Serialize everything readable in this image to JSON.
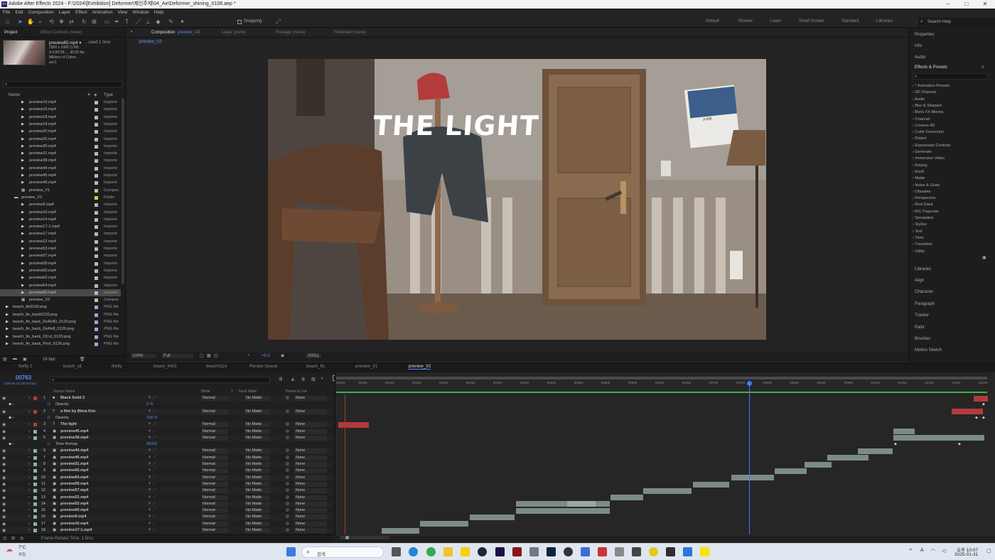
{
  "window_title": "Adobe After Effects 2024 - F:\\2024\\[Exhibition] Deformer\\제인주제\\04_Ae\\Deformer_shining_0108.aep *",
  "menu": [
    "File",
    "Edit",
    "Composition",
    "Layer",
    "Effect",
    "Animation",
    "View",
    "Window",
    "Help"
  ],
  "toolbar": {
    "snapping_label": "Snapping",
    "workspaces": [
      "Default",
      "Review",
      "Learn",
      "Small Screen",
      "Standard",
      "Libraries"
    ],
    "search_help": "Search Help"
  },
  "project": {
    "tab_project": "Project",
    "tab_effect_controls": "Effect Controls (none)",
    "thumb_name": "preview65.mp4 ▾",
    "thumb_used": ", used 1 time",
    "thumb_info1": "2560 x 1080 (1.00)",
    "thumb_info2": "Δ 0;00;08;..., 30.00 fps",
    "thumb_info3": "Millions of Colors",
    "thumb_info4": "avc1",
    "col_name": "Name",
    "col_type": "Type",
    "items": [
      {
        "name": "preview15.mp4",
        "type": "Importe",
        "indent": 2,
        "color": "#aebbc8"
      },
      {
        "name": "preview16.mp4",
        "type": "Importe",
        "indent": 2,
        "color": "#aebbc8"
      },
      {
        "name": "preview18.mp4",
        "type": "Importe",
        "indent": 2,
        "color": "#aebbc8"
      },
      {
        "name": "preview19.mp4",
        "type": "Importe",
        "indent": 2,
        "color": "#aebbc8"
      },
      {
        "name": "preview20.mp4",
        "type": "Importe",
        "indent": 2,
        "color": "#aebbc8"
      },
      {
        "name": "preview25.mp4",
        "type": "Importe",
        "indent": 2,
        "color": "#aebbc8"
      },
      {
        "name": "preview30.mp4",
        "type": "Importe",
        "indent": 2,
        "color": "#aebbc8"
      },
      {
        "name": "preview31.mp4",
        "type": "Importe",
        "indent": 2,
        "color": "#aebbc8"
      },
      {
        "name": "preview38.mp4",
        "type": "Importe",
        "indent": 2,
        "color": "#aebbc8"
      },
      {
        "name": "preview44.mp4",
        "type": "Importe",
        "indent": 2,
        "color": "#aebbc8"
      },
      {
        "name": "preview45.mp4",
        "type": "Importe",
        "indent": 2,
        "color": "#aebbc8"
      },
      {
        "name": "preview46.mp4",
        "type": "Importe",
        "indent": 2,
        "color": "#aebbc8"
      },
      {
        "name": "preview_V1",
        "type": "Compos",
        "indent": 2,
        "color": "#d8b88a"
      },
      {
        "name": "preview_V2",
        "type": "Folder",
        "indent": 1,
        "color": "#e0c850"
      },
      {
        "name": "preview9.mp4",
        "type": "Importe",
        "indent": 2,
        "color": "#aebbc8"
      },
      {
        "name": "preview10.mp4",
        "type": "Importe",
        "indent": 2,
        "color": "#aebbc8"
      },
      {
        "name": "preview14.mp4",
        "type": "Importe",
        "indent": 2,
        "color": "#aebbc8"
      },
      {
        "name": "preview17-1.mp4",
        "type": "Importe",
        "indent": 2,
        "color": "#aebbc8"
      },
      {
        "name": "preview17.mp4",
        "type": "Importe",
        "indent": 2,
        "color": "#aebbc8"
      },
      {
        "name": "preview22.mp4",
        "type": "Importe",
        "indent": 2,
        "color": "#aebbc8"
      },
      {
        "name": "preview53.mp4",
        "type": "Importe",
        "indent": 2,
        "color": "#aebbc8"
      },
      {
        "name": "preview57.mp4",
        "type": "Importe",
        "indent": 2,
        "color": "#aebbc8"
      },
      {
        "name": "preview59.mp4",
        "type": "Importe",
        "indent": 2,
        "color": "#aebbc8"
      },
      {
        "name": "preview60.mp4",
        "type": "Importe",
        "indent": 2,
        "color": "#aebbc8"
      },
      {
        "name": "preview62.mp4",
        "type": "Importe",
        "indent": 2,
        "color": "#aebbc8"
      },
      {
        "name": "preview64.mp4",
        "type": "Importe",
        "indent": 2,
        "color": "#aebbc8"
      },
      {
        "name": "preview65.mp4",
        "type": "Importe",
        "indent": 2,
        "color": "#aebbc8",
        "selected": true
      },
      {
        "name": "preview_V2",
        "type": "Compos",
        "indent": 2,
        "color": "#d8b88a"
      },
      {
        "name": "beach_fin0100.png",
        "type": "PNG file",
        "indent": 0,
        "color": "#b89ad0"
      },
      {
        "name": "beach_fin_back0120.png",
        "type": "PNG file",
        "indent": 0,
        "color": "#b89ad0"
      },
      {
        "name": "beach_fin_back_DeRefD_0120.png",
        "type": "PNG file",
        "indent": 0,
        "color": "#b89ad0"
      },
      {
        "name": "beach_fin_back_DeRefl_0120.png",
        "type": "PNG file",
        "indent": 0,
        "color": "#b89ad0"
      },
      {
        "name": "beach_fin_back_OCol_0120.png",
        "type": "PNG file",
        "indent": 0,
        "color": "#b89ad0"
      },
      {
        "name": "beach_fin_back_Post_0120.png",
        "type": "PNG file",
        "indent": 0,
        "color": "#b89ad0"
      }
    ],
    "bpc": "16 bpc"
  },
  "comp_panel": {
    "tab_composition": "Composition",
    "tab_comp_name": "preview_V2",
    "tab_layer": "Layer (none)",
    "tab_footage": "Footage (none)",
    "tab_flowchart": "Flowchart (none)",
    "breadcrumb": "preview_V2",
    "title_text": "THE LIGHT",
    "calendar_month": "JUNE",
    "zoom": "100%",
    "quality": "Full",
    "exposure": "+0.0",
    "timecode": "00011"
  },
  "right_panel": {
    "top_items": [
      "Properties",
      "Info",
      "Audio"
    ],
    "effects_title": "Effects & Presets",
    "effects": [
      "* Animation Presets",
      "3D Channel",
      "Audio",
      "Blur & Sharpen",
      "Boris FX Mocha",
      "Channel",
      "Cinema 4D",
      "Color Correction",
      "Distort",
      "Expression Controls",
      "Generate",
      "Immersive Video",
      "Keying",
      "Knoll",
      "Matte",
      "Noise & Grain",
      "Obsolete",
      "Perspective",
      "Red Giant",
      "RG Trapcode",
      "Simulation",
      "Stylize",
      "Text",
      "Time",
      "Transition",
      "Utility"
    ],
    "bottom_items": [
      "Libraries",
      "Align",
      "Character",
      "Paragraph",
      "Tracker",
      "Paint",
      "Brushes",
      "Motion Sketch"
    ]
  },
  "timeline": {
    "tabs": [
      "firefly 2",
      "beach_sit",
      "firefly",
      "beach_fin02",
      "beach0114",
      "Render Queue",
      "beach_fin",
      "preview_V1",
      "preview_V2"
    ],
    "current_time": "00763",
    "fps_info": "0;00;25;13 (30.00 fps)",
    "col_source": "Source Name",
    "col_mode": "Mode",
    "col_t": "T",
    "col_trackmatte": "Track Matte",
    "col_parent": "Parent & Link",
    "ruler": [
      "00000",
      "00050",
      "00100",
      "00150",
      "00200",
      "00250",
      "00300",
      "00350",
      "00400",
      "00450",
      "00500",
      "00550",
      "00600",
      "00650",
      "00700",
      "00750",
      "00800",
      "00850",
      "00900",
      "00950",
      "01000",
      "01050",
      "01100",
      "01150",
      "01200"
    ],
    "layers": [
      {
        "num": "1",
        "name": "Black Solid 2",
        "kind": "solid",
        "label": "#b93a3a",
        "mode": "Normal",
        "tm": "No Matte",
        "parent": "None"
      },
      {
        "num": "",
        "name": "Opacity",
        "kind": "prop",
        "value": "0 %"
      },
      {
        "num": "2",
        "name": "a film by Bitna Kim",
        "kind": "text",
        "label": "#b93a3a",
        "mode": "Normal",
        "tm": "No Matte",
        "parent": "None"
      },
      {
        "num": "",
        "name": "Opacity",
        "kind": "prop",
        "value": "100 %"
      },
      {
        "num": "3",
        "name": "The light",
        "kind": "text",
        "label": "#b93a3a",
        "mode": "Normal",
        "tm": "No Matte",
        "parent": "None"
      },
      {
        "num": "4",
        "name": "preview45.mp4",
        "kind": "video",
        "label": "#8fb0b0",
        "mode": "Normal",
        "tm": "No Matte",
        "parent": "None"
      },
      {
        "num": "5",
        "name": "preview38.mp4",
        "kind": "video",
        "label": "#8fb0b0",
        "mode": "Normal",
        "tm": "No Matte",
        "parent": "None"
      },
      {
        "num": "",
        "name": "Time Remap",
        "kind": "prop",
        "value": "00000"
      },
      {
        "num": "6",
        "name": "preview44.mp4",
        "kind": "video",
        "label": "#8fb0b0",
        "mode": "Normal",
        "tm": "No Matte",
        "parent": "None"
      },
      {
        "num": "7",
        "name": "preview46.mp4",
        "kind": "video",
        "label": "#8fb0b0",
        "mode": "Normal",
        "tm": "No Matte",
        "parent": "None"
      },
      {
        "num": "8",
        "name": "preview31.mp4",
        "kind": "video",
        "label": "#8fb0b0",
        "mode": "Normal",
        "tm": "No Matte",
        "parent": "None"
      },
      {
        "num": "9",
        "name": "preview65.mp4",
        "kind": "video",
        "label": "#8fb0b0",
        "mode": "Normal",
        "tm": "No Matte",
        "parent": "None"
      },
      {
        "num": "10",
        "name": "preview64.mp4",
        "kind": "video",
        "label": "#8fb0b0",
        "mode": "Normal",
        "tm": "No Matte",
        "parent": "None"
      },
      {
        "num": "11",
        "name": "preview59.mp4",
        "kind": "video",
        "label": "#8fb0b0",
        "mode": "Normal",
        "tm": "No Matte",
        "parent": "None"
      },
      {
        "num": "12",
        "name": "preview57.mp4",
        "kind": "video",
        "label": "#8fb0b0",
        "mode": "Normal",
        "tm": "No Matte",
        "parent": "None"
      },
      {
        "num": "13",
        "name": "preview22.mp4",
        "kind": "video",
        "label": "#8fb0b0",
        "mode": "Normal",
        "tm": "No Matte",
        "parent": "None"
      },
      {
        "num": "14",
        "name": "preview53.mp4",
        "kind": "video",
        "label": "#8fb0b0",
        "mode": "Normal",
        "tm": "No Matte",
        "parent": "None"
      },
      {
        "num": "15",
        "name": "preview60.mp4",
        "kind": "video",
        "label": "#8fb0b0",
        "mode": "Normal",
        "tm": "No Matte",
        "parent": "None"
      },
      {
        "num": "16",
        "name": "preview9.mp4",
        "kind": "video",
        "label": "#8fb0b0",
        "mode": "Normal",
        "tm": "No Matte",
        "parent": "None"
      },
      {
        "num": "17",
        "name": "preview10.mp4",
        "kind": "video",
        "label": "#8fb0b0",
        "mode": "Normal",
        "tm": "No Matte",
        "parent": "None"
      },
      {
        "num": "18",
        "name": "preview17-1.mp4",
        "kind": "video",
        "label": "#8fb0b0",
        "mode": "Normal",
        "tm": "No Matte",
        "parent": "None"
      }
    ],
    "frame_render": "Frame Render Time: 1.5ms"
  },
  "taskbar": {
    "search": "검색",
    "time": "오후 10:07",
    "date": "2025-01-31",
    "weather": "7°C",
    "weather_sub": "흐림"
  }
}
